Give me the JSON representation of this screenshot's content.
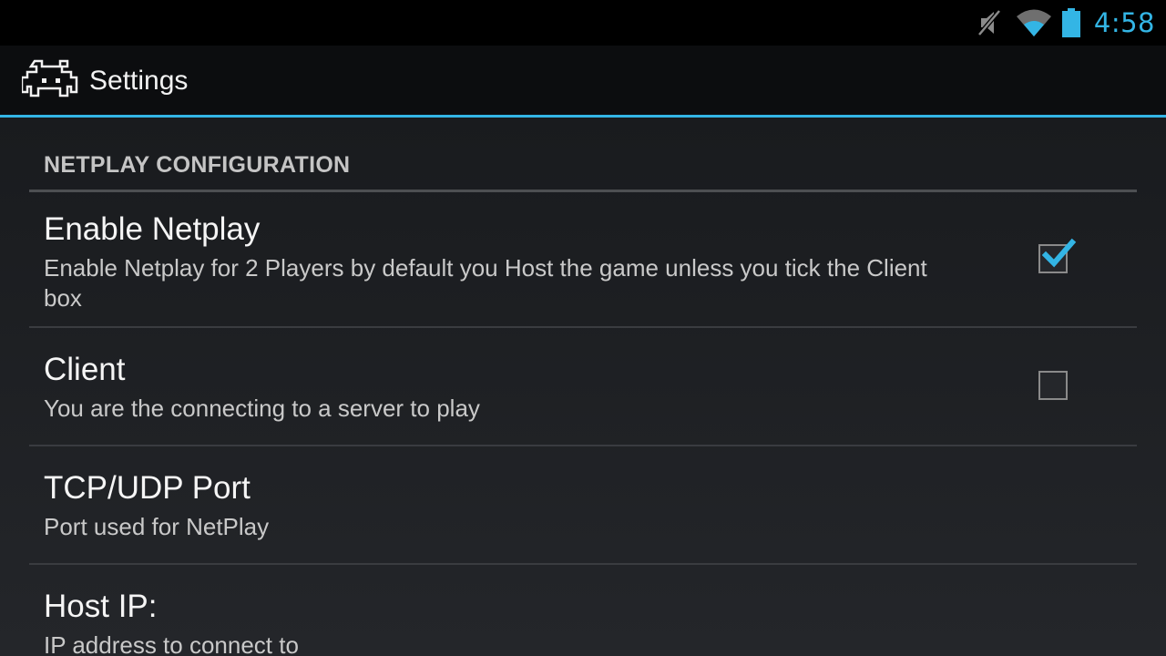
{
  "status_bar": {
    "time": "4:58",
    "icons": [
      "mute-icon",
      "wifi-icon",
      "battery-icon"
    ],
    "accent_color": "#33b5e5"
  },
  "action_bar": {
    "title": "Settings",
    "app_icon": "space-invader-icon"
  },
  "section": {
    "header": "NETPLAY CONFIGURATION"
  },
  "preferences": [
    {
      "title": "Enable Netplay",
      "summary": "Enable Netplay for 2 Players by default you Host the game unless you tick the Client box",
      "checked": true
    },
    {
      "title": "Client",
      "summary": "You are the connecting to a server to play",
      "checked": false
    },
    {
      "title": "TCP/UDP Port",
      "summary": "Port used for NetPlay"
    },
    {
      "title": "Host IP:",
      "summary": "IP address to connect to"
    }
  ]
}
